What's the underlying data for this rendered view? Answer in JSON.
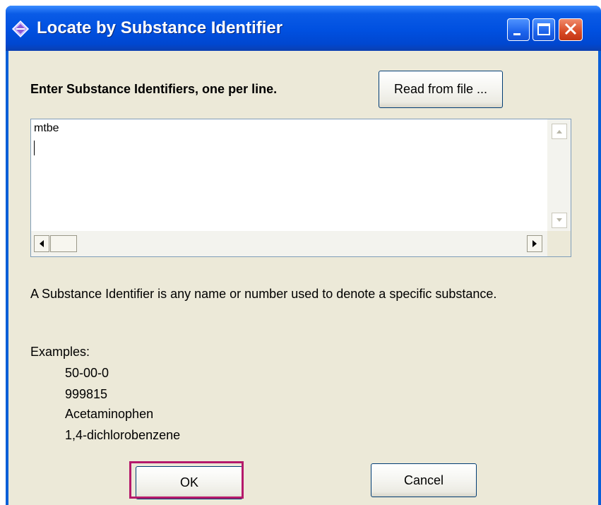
{
  "window": {
    "title": "Locate by Substance Identifier",
    "accent_color": "#0050e0",
    "controls": {
      "minimize": "minimize-icon",
      "maximize": "maximize-icon",
      "close": "close-icon"
    }
  },
  "form": {
    "prompt": "Enter Substance Identifiers, one per line.",
    "read_file_label": "Read from file ...",
    "text_value": "mtbe",
    "description": "A Substance Identifier is any name or number used to denote a specific substance.",
    "examples_label": "Examples:",
    "examples": [
      "50-00-0",
      "999815",
      "Acetaminophen",
      "1,4-dichlorobenzene"
    ],
    "ok_label": "OK",
    "cancel_label": "Cancel",
    "highlight_color": "#b5196b"
  }
}
